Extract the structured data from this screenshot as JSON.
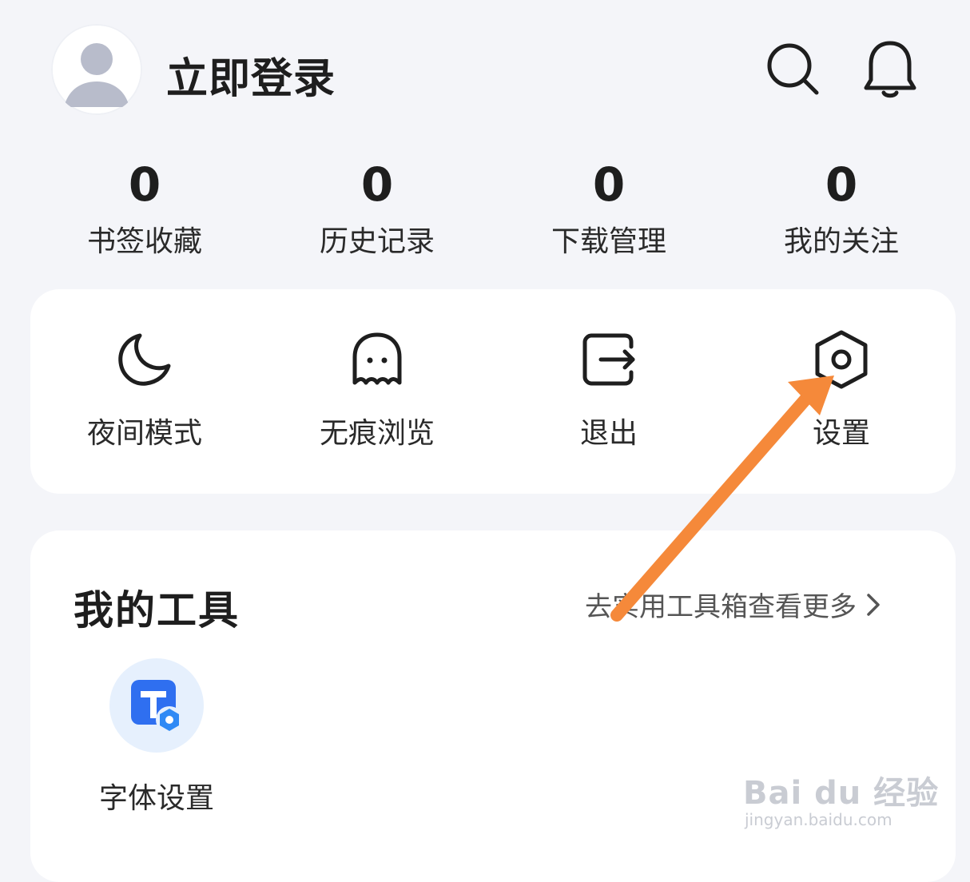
{
  "header": {
    "login_text": "立即登录",
    "icons": [
      "avatar-icon",
      "search-icon",
      "bell-icon"
    ]
  },
  "stats": [
    {
      "value": "0",
      "label": "书签收藏"
    },
    {
      "value": "0",
      "label": "历史记录"
    },
    {
      "value": "0",
      "label": "下载管理"
    },
    {
      "value": "0",
      "label": "我的关注"
    }
  ],
  "quick_actions": [
    {
      "label": "夜间模式",
      "icon": "moon-icon"
    },
    {
      "label": "无痕浏览",
      "icon": "ghost-icon"
    },
    {
      "label": "退出",
      "icon": "exit-icon"
    },
    {
      "label": "设置",
      "icon": "settings-hexagon-icon"
    }
  ],
  "tools": {
    "title": "我的工具",
    "more_link": "去实用工具箱查看更多",
    "items": [
      {
        "label": "字体设置",
        "icon": "font-settings-icon"
      }
    ]
  },
  "watermark": {
    "brand": "Bai du 经验",
    "url": "jingyan.baidu.com"
  },
  "colors": {
    "background": "#f4f5f9",
    "card": "#ffffff",
    "annotation_arrow": "#f5893a",
    "tool_blue": "#2f6ff0"
  }
}
